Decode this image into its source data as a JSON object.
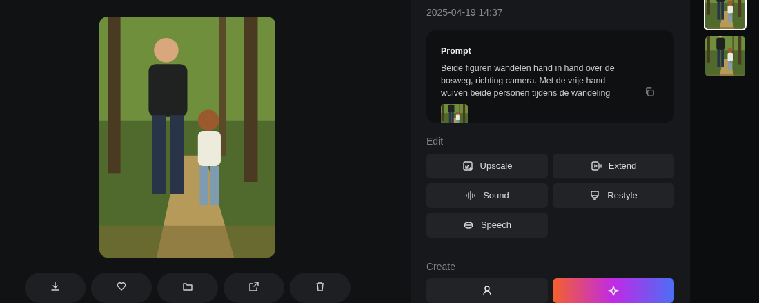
{
  "viewer": {
    "actions": [
      {
        "kind": "download"
      },
      {
        "kind": "heart"
      },
      {
        "kind": "folder"
      },
      {
        "kind": "share"
      },
      {
        "kind": "trash"
      }
    ]
  },
  "details": {
    "date": "2025-04-19 14:37",
    "prompt": {
      "title": "Prompt",
      "text": "Beide figuren wandelen hand in hand over de bosweg, richting camera. Met de vrije hand wuiven beide personen tijdens de wandeling"
    },
    "edit": {
      "title": "Edit",
      "buttons": [
        {
          "kind": "upscale",
          "label": "Upscale"
        },
        {
          "kind": "extend",
          "label": "Extend"
        },
        {
          "kind": "sound",
          "label": "Sound"
        },
        {
          "kind": "restyle",
          "label": "Restyle"
        },
        {
          "kind": "speech",
          "label": "Speech"
        }
      ]
    },
    "create": {
      "title": "Create",
      "buttons": [
        {
          "kind": "plain"
        },
        {
          "kind": "gradient"
        }
      ]
    }
  },
  "thumbnails": [
    {
      "selected": true
    },
    {
      "selected": false
    }
  ]
}
